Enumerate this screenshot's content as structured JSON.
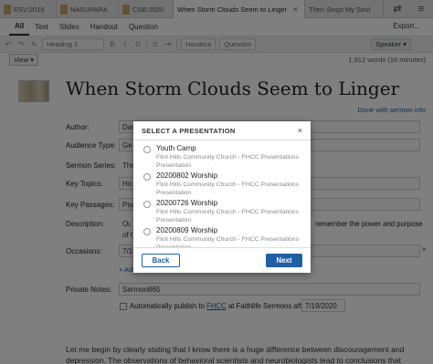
{
  "tabs": [
    {
      "label": "ESV:2016",
      "active": false
    },
    {
      "label": "NASUPARA",
      "active": false
    },
    {
      "label": "CSB:2020",
      "active": false
    },
    {
      "label": "When Storm Clouds Seem to Linger",
      "active": true
    },
    {
      "label": "Then Sings My Soul",
      "active": false
    }
  ],
  "filters": [
    "All",
    "Text",
    "Slides",
    "Handout",
    "Question"
  ],
  "toolbar": {
    "heading": "Heading 2",
    "handout": "Handout",
    "question": "Question",
    "export": "Export...",
    "speaker": "Speaker"
  },
  "view": {
    "label": "View",
    "wordcount": "1,912 words (16 minutes)"
  },
  "document": {
    "title": "When Storm Clouds Seem to Linger",
    "done_link": "Done with sermon info",
    "author_label": "Author:",
    "author_value": "Dav",
    "audience_label": "Audience Type:",
    "audience_value": "Ge",
    "series_label": "Sermon Series:",
    "series_value": "The",
    "topics_label": "Key Topics:",
    "topics_value": "Ho",
    "passages_label": "Key Passages:",
    "passages_value": "Psa",
    "description_label": "Description:",
    "description_value": "Our",
    "description_right1": "remember the power and purpose",
    "description_value2": "of G",
    "occasions_label": "Occasions:",
    "occasions_value": "7/19",
    "occasions_close": "×",
    "add_link": "+ Add",
    "private_notes_label": "Private Notes:",
    "private_notes_value": "Sermon865",
    "publish_prefix": "Automatically publish to ",
    "publish_link": "FHCC",
    "publish_suffix": " at Faithlife Sermons after",
    "publish_date": "7/19/2020",
    "body": "Let me begin by clearly stating that I know there is a huge difference between discouragement and depression. The observations of behavioral scientists and neurobiologists lead to conclusions that"
  },
  "dialog": {
    "title": "SELECT A PRESENTATION",
    "close": "×",
    "items": [
      {
        "name": "Youth Camp",
        "church": "Flint Hills Community Church - FHCC Presentations",
        "type": "Presentation"
      },
      {
        "name": "20200802 Worship",
        "church": "Flint Hills Community Church - FHCC Presentations",
        "type": "Presentation"
      },
      {
        "name": "20200726 Worship",
        "church": "Flint Hills Community Church - FHCC Presentations",
        "type": "Presentation"
      },
      {
        "name": "20200809 Worship",
        "church": "Flint Hills Community Church - FHCC Presentations",
        "type": "Presentation"
      }
    ],
    "back": "Back",
    "next": "Next"
  },
  "colors": {
    "accent": "#1f5fa8",
    "link": "#1a5dab",
    "overlay": "rgba(0,0,0,0.5)"
  }
}
